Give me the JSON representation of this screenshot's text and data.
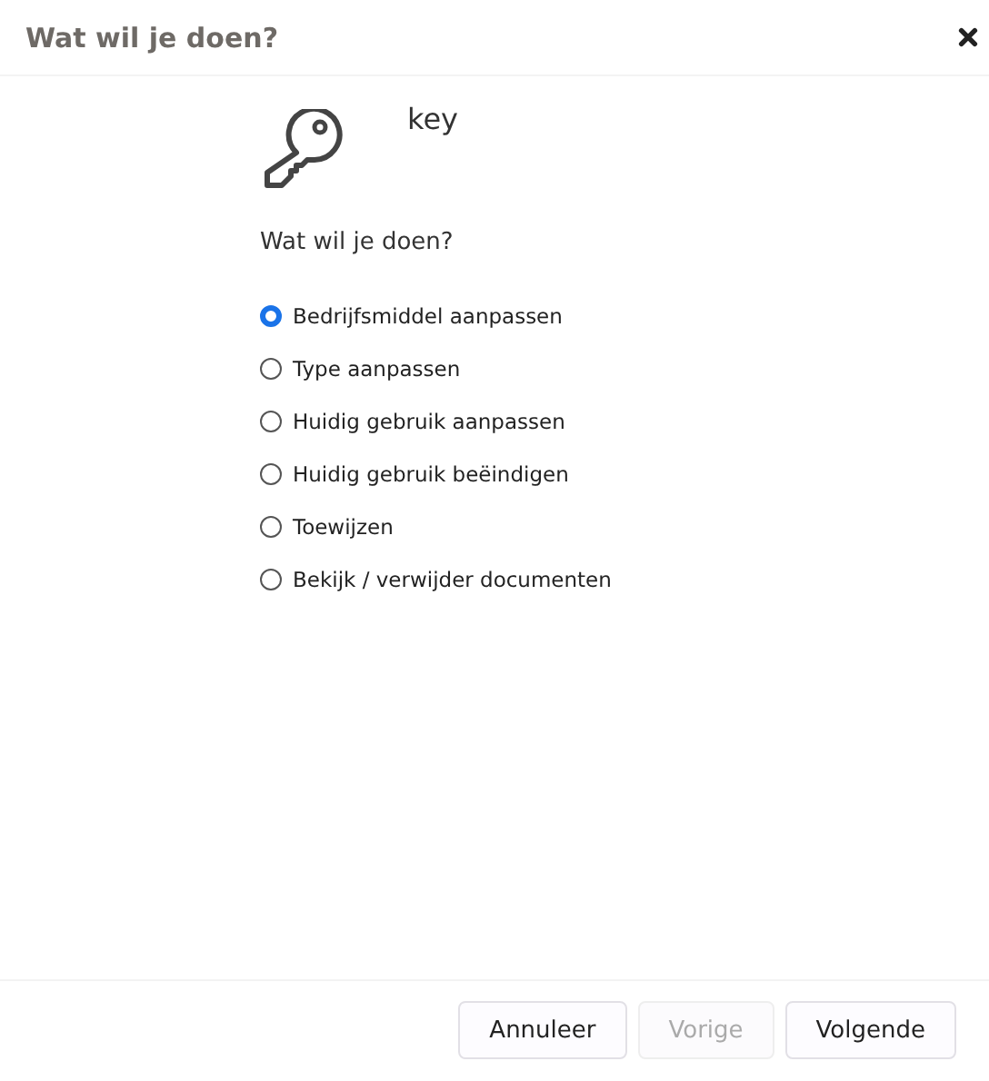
{
  "dialog": {
    "title": "Wat wil je doen?"
  },
  "asset": {
    "name": "key"
  },
  "question": "Wat wil je doen?",
  "options": [
    {
      "label": "Bedrijfsmiddel aanpassen",
      "selected": true
    },
    {
      "label": "Type aanpassen",
      "selected": false
    },
    {
      "label": "Huidig gebruik aanpassen",
      "selected": false
    },
    {
      "label": "Huidig gebruik beëindigen",
      "selected": false
    },
    {
      "label": "Toewijzen",
      "selected": false
    },
    {
      "label": "Bekijk / verwijder documenten",
      "selected": false
    }
  ],
  "buttons": [
    {
      "label": "Annuleer",
      "disabled": false
    },
    {
      "label": "Vorige",
      "disabled": true
    },
    {
      "label": "Volgende",
      "disabled": false
    }
  ]
}
